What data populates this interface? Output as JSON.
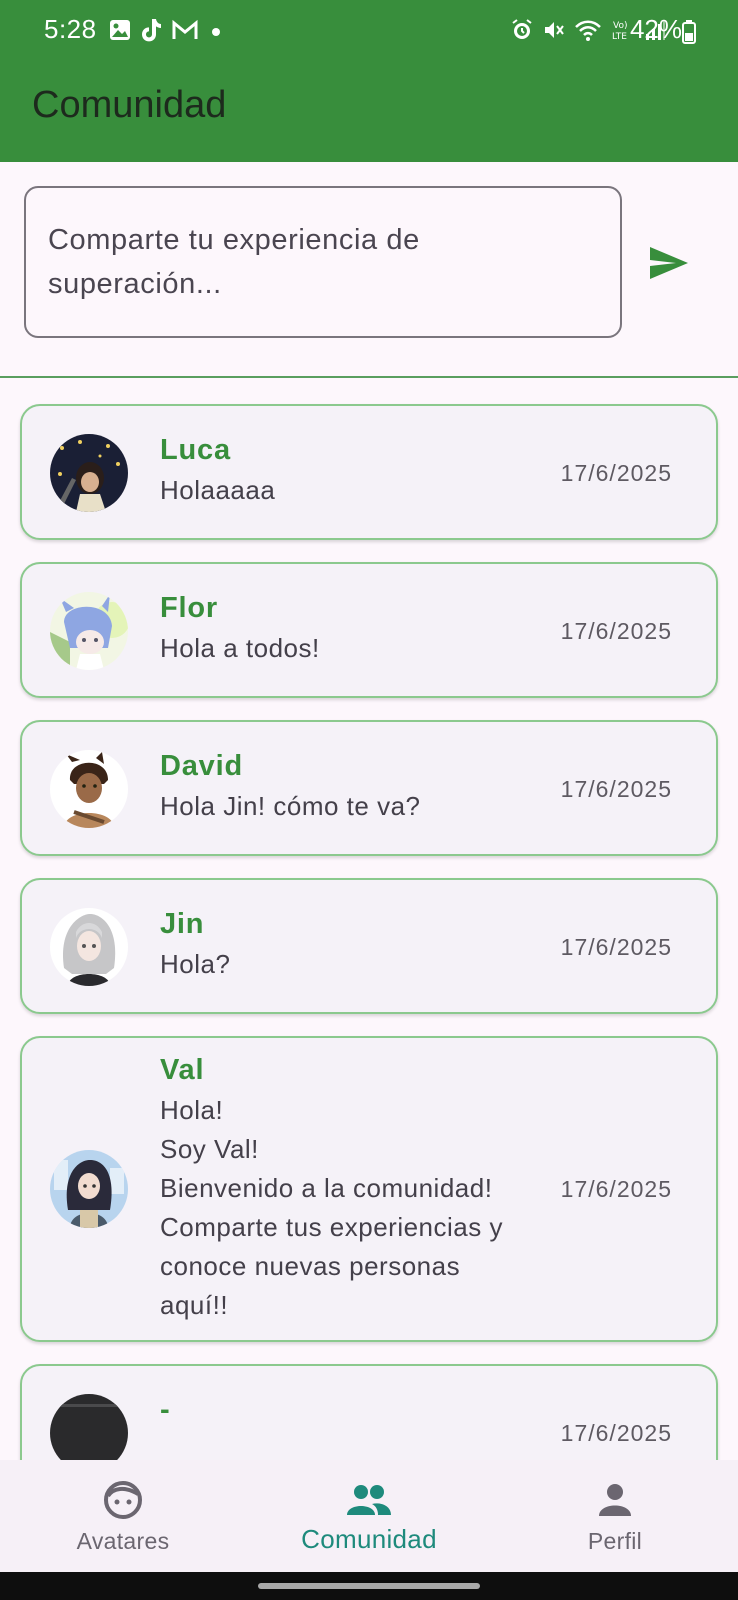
{
  "status_bar": {
    "time": "5:28",
    "battery": "42%",
    "left_icons": [
      "gallery-icon",
      "tiktok-icon",
      "gmail-icon",
      "dot-icon"
    ],
    "right_icons": [
      "alarm-icon",
      "mute-icon",
      "wifi-icon",
      "volte-icon",
      "signal-icon",
      "battery-icon"
    ]
  },
  "app_bar": {
    "title": "Comunidad",
    "color": "#388e3c"
  },
  "composer": {
    "placeholder": "Comparte tu experiencia de superación...",
    "send_icon": "send-icon"
  },
  "posts": [
    {
      "name": "Luca",
      "text": "Holaaaaa",
      "date": "17/6/2025",
      "avatar": "avatar-luca"
    },
    {
      "name": "Flor",
      "text": "Hola a todos!",
      "date": "17/6/2025",
      "avatar": "avatar-flor"
    },
    {
      "name": "David",
      "text": "Hola Jin! cómo te va?",
      "date": "17/6/2025",
      "avatar": "avatar-david"
    },
    {
      "name": "Jin",
      "text": "Hola?",
      "date": "17/6/2025",
      "avatar": "avatar-jin"
    },
    {
      "name": "Val",
      "text": "Hola!\nSoy Val!\nBienvenido a la comunidad!\nComparte tus experiencias y conoce nuevas personas aquí!!",
      "date": "17/6/2025",
      "avatar": "avatar-val"
    },
    {
      "name": "-",
      "text": "",
      "date": "17/6/2025",
      "avatar": "avatar-dark"
    }
  ],
  "bottom_nav": {
    "items": [
      {
        "label": "Avatares",
        "icon": "face-icon",
        "active": false
      },
      {
        "label": "Comunidad",
        "icon": "group-icon",
        "active": true
      },
      {
        "label": "Perfil",
        "icon": "person-icon",
        "active": false
      }
    ]
  },
  "colors": {
    "accent": "#388e3c",
    "active_nav": "#1e8a7c",
    "card_border": "#8bc98e"
  }
}
